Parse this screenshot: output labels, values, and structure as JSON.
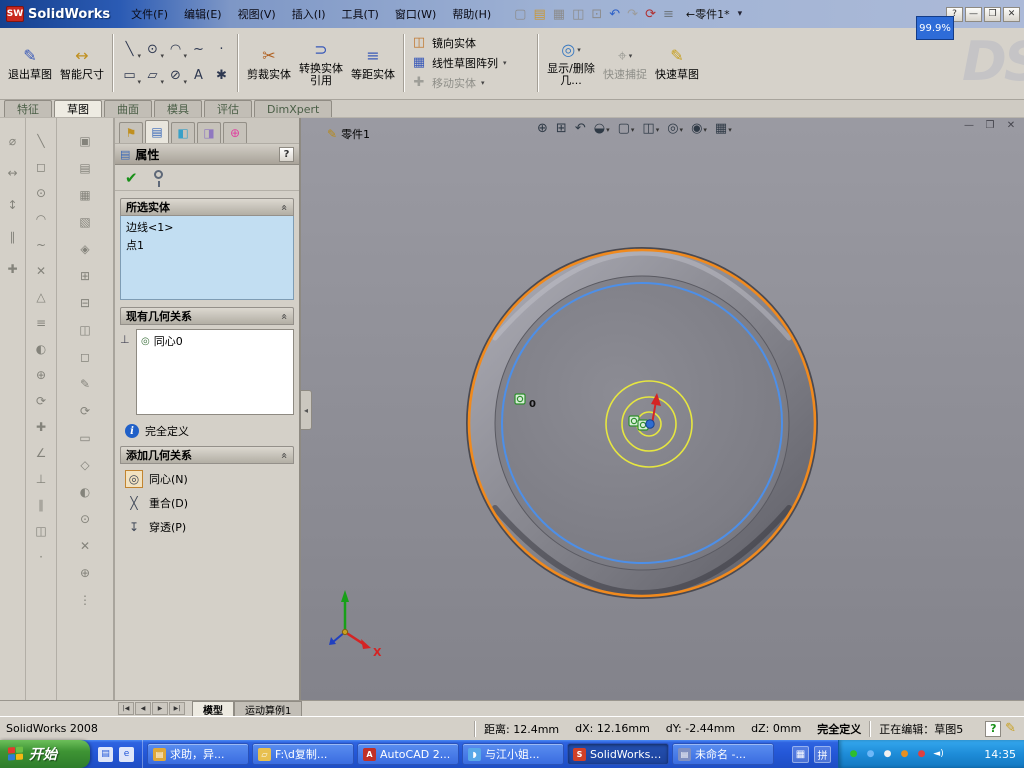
{
  "colors": {
    "selection_orange": "#F08A1E",
    "edge_blue": "#4D8FE8",
    "sketch_yellow": "#E6E640",
    "relation_green": "#2E8E2E",
    "axis_red": "#D42424",
    "axis_green": "#18A018",
    "axis_blue": "#2040C0"
  },
  "titlebar": {
    "logo_badge": "SW",
    "app_name": "SolidWorks",
    "menus": [
      "文件(F)",
      "编辑(E)",
      "视图(V)",
      "插入(I)",
      "工具(T)",
      "窗口(W)",
      "帮助(H)"
    ],
    "toolbar_icons": [
      {
        "name": "new-document-icon",
        "glyph": "▢",
        "color": "#8C8C8C"
      },
      {
        "name": "open-icon",
        "glyph": "▤",
        "color": "#C89838"
      },
      {
        "name": "save-icon",
        "glyph": "▦",
        "color": "#8C8C8C"
      },
      {
        "name": "print-icon",
        "glyph": "◫",
        "color": "#8C8C8C"
      },
      {
        "name": "print-preview-icon",
        "glyph": "⊡",
        "color": "#8C8C8C"
      },
      {
        "name": "undo-icon",
        "glyph": "↶",
        "color": "#2E62C8"
      },
      {
        "name": "redo-icon",
        "glyph": "↷",
        "color": "#9C9C9C"
      },
      {
        "name": "rebuild-icon",
        "glyph": "⟳",
        "color": "#B03030"
      },
      {
        "name": "options-icon",
        "glyph": "≡",
        "color": "#707880"
      }
    ],
    "part_label": "←零件1*",
    "help_label": "?",
    "zoom_badge": "99.9%",
    "watermark": "DS"
  },
  "sketch_toolbar": {
    "exit_sketch": "退出草图",
    "smart_dimension": "智能尺寸",
    "draw_tools": [
      {
        "name": "line-icon",
        "glyph": "╲",
        "caret": true
      },
      {
        "name": "circle-icon",
        "glyph": "⊙",
        "caret": true
      },
      {
        "name": "arc-icon",
        "glyph": "◠",
        "caret": true
      },
      {
        "name": "spline-icon",
        "glyph": "~"
      },
      {
        "name": "point-icon",
        "glyph": "·"
      },
      {
        "name": "rectangle-icon",
        "glyph": "▭",
        "caret": true
      },
      {
        "name": "slot-icon",
        "glyph": "▱",
        "caret": true
      },
      {
        "name": "ellipse-icon",
        "glyph": "⊘",
        "caret": true
      },
      {
        "name": "sketch-text-icon",
        "glyph": "A"
      },
      {
        "name": "star-icon",
        "glyph": "✱"
      }
    ],
    "trim": "剪裁实体",
    "convert": "转换实体引用",
    "offset": "等距实体",
    "mirror": "镜向实体",
    "linear_pattern": "线性草图阵列",
    "move": "移动实体",
    "display_delete": "显示/删除几...",
    "quick_snap": "快速捕捉",
    "rapid_sketch": "快速草图"
  },
  "command_tabs": [
    {
      "name": "features-tab",
      "label": "特征"
    },
    {
      "name": "sketch-tab",
      "label": "草图",
      "active": true
    },
    {
      "name": "surfaces-tab",
      "label": "曲面"
    },
    {
      "name": "mold-tab",
      "label": "模具"
    },
    {
      "name": "evaluate-tab",
      "label": "评估"
    },
    {
      "name": "dimxpert-tab",
      "label": "DimXpert"
    }
  ],
  "left_strips": {
    "col1": [
      {
        "name": "dimension-icon",
        "glyph": "⌀"
      },
      {
        "name": "horizontal-relation-icon",
        "glyph": "↔"
      },
      {
        "name": "vertical-relation-icon",
        "glyph": "↕"
      },
      {
        "name": "parallel-relation-icon",
        "glyph": "∥"
      },
      {
        "name": "fix-relation-icon",
        "glyph": "✚"
      }
    ],
    "col2": [
      {
        "name": "line-tool-icon",
        "glyph": "╲"
      },
      {
        "name": "rectangle-tool-icon",
        "glyph": "◻"
      },
      {
        "name": "circle-tool-icon",
        "glyph": "⊙"
      },
      {
        "name": "arc-tool-icon",
        "glyph": "◠"
      },
      {
        "name": "spline-tool-icon",
        "glyph": "~"
      },
      {
        "name": "erase-tool-icon",
        "glyph": "✕"
      },
      {
        "name": "polygon-tool-icon",
        "glyph": "△"
      },
      {
        "name": "pattern-tool-icon",
        "glyph": "≡"
      },
      {
        "name": "fillet-tool-icon",
        "glyph": "◐"
      },
      {
        "name": "offset-tool-icon",
        "glyph": "⊕"
      },
      {
        "name": "rotate-tool-icon",
        "glyph": "⟳"
      },
      {
        "name": "add-relation-icon",
        "glyph": "✚"
      },
      {
        "name": "angle-tool-icon",
        "glyph": "∠"
      },
      {
        "name": "perpendicular-tool-icon",
        "glyph": "⊥"
      },
      {
        "name": "parallel-tool-icon",
        "glyph": "∥"
      },
      {
        "name": "mirror-tool-icon",
        "glyph": "◫"
      },
      {
        "name": "point-tool-icon",
        "glyph": "·"
      }
    ],
    "col3": [
      {
        "name": "extrude-icon",
        "glyph": "▣"
      },
      {
        "name": "revolve-icon",
        "glyph": "▤"
      },
      {
        "name": "sweep-icon",
        "glyph": "▦"
      },
      {
        "name": "loft-icon",
        "glyph": "▧"
      },
      {
        "name": "shell-icon",
        "glyph": "◈"
      },
      {
        "name": "feature-pattern-icon",
        "glyph": "⊞"
      },
      {
        "name": "feature-mirror-icon",
        "glyph": "⊟"
      },
      {
        "name": "rib-icon",
        "glyph": "◫"
      },
      {
        "name": "draft-icon",
        "glyph": "◻"
      },
      {
        "name": "sketch-edit-icon",
        "glyph": "✎"
      },
      {
        "name": "rebuild-tree-icon",
        "glyph": "⟳"
      },
      {
        "name": "plane-icon",
        "glyph": "▭"
      },
      {
        "name": "axis-icon",
        "glyph": "◇"
      },
      {
        "name": "fillet-feature-icon",
        "glyph": "◐"
      },
      {
        "name": "hole-icon",
        "glyph": "⊙"
      },
      {
        "name": "delete-feature-icon",
        "glyph": "✕"
      },
      {
        "name": "add-feature-icon",
        "glyph": "⊕"
      },
      {
        "name": "more-tools-icon",
        "glyph": "⋮"
      }
    ]
  },
  "property_manager": {
    "tabs": [
      {
        "name": "feature-manager-tab",
        "glyph": "⚑",
        "color": "#C09020"
      },
      {
        "name": "property-manager-tab",
        "glyph": "▤",
        "color": "#3868B8",
        "active": true
      },
      {
        "name": "configuration-manager-tab",
        "glyph": "◧",
        "color": "#38A0C8"
      },
      {
        "name": "dimxpert-manager-tab",
        "glyph": "◨",
        "color": "#9078C0"
      },
      {
        "name": "display-manager-tab",
        "glyph": "⊕",
        "color": "#E040A0"
      }
    ],
    "title": "属性",
    "help_label": "?",
    "selected_entities": {
      "header": "所选实体",
      "items": [
        "边线<1>",
        "点1"
      ]
    },
    "existing_relations": {
      "header": "现有几何关系",
      "items": [
        {
          "name": "concentric-relation-item",
          "glyph": "◎",
          "label": "同心0"
        }
      ],
      "status": "完全定义"
    },
    "add_relations": {
      "header": "添加几何关系",
      "options": [
        {
          "name": "concentric-relation-option",
          "glyph": "◎",
          "label": "同心(N)",
          "active": true
        },
        {
          "name": "coincident-relation-option",
          "glyph": "╳",
          "label": "重合(D)"
        },
        {
          "name": "pierce-relation-option",
          "glyph": "↧",
          "label": "穿透(P)"
        }
      ]
    }
  },
  "viewport": {
    "model_label": "零件1",
    "hud_icons": [
      {
        "name": "zoom-fit-icon",
        "glyph": "⊕"
      },
      {
        "name": "zoom-area-icon",
        "glyph": "⊞"
      },
      {
        "name": "previous-view-icon",
        "glyph": "↶"
      },
      {
        "name": "section-view-icon",
        "glyph": "◒",
        "caret": true
      },
      {
        "name": "view-orientation-icon",
        "glyph": "▢",
        "caret": true
      },
      {
        "name": "display-style-icon",
        "glyph": "◫",
        "caret": true
      },
      {
        "name": "hide-show-items-icon",
        "glyph": "◎",
        "caret": true
      },
      {
        "name": "appearance-icon",
        "glyph": "◉",
        "caret": true
      },
      {
        "name": "scene-icon",
        "glyph": "▦",
        "caret": true
      }
    ],
    "window_buttons": {
      "minimize": "—",
      "restore": "❒",
      "close": "✕"
    },
    "origin_point_label": "0",
    "axis_x_label": "X"
  },
  "model_tabs": {
    "nav": [
      {
        "name": "first-tab-button",
        "glyph": "|◀"
      },
      {
        "name": "prev-tab-button",
        "glyph": "◀"
      },
      {
        "name": "next-tab-button",
        "glyph": "▶"
      },
      {
        "name": "last-tab-button",
        "glyph": "▶|"
      }
    ],
    "tabs": [
      {
        "name": "model-tab",
        "label": "模型",
        "active": true
      },
      {
        "name": "motion-study-tab",
        "label": "运动算例1"
      }
    ]
  },
  "statusbar": {
    "app_version": "SolidWorks 2008",
    "distance": "距离: 12.4mm",
    "dx": "dX: 12.16mm",
    "dy": "dY: -2.44mm",
    "dz": "dZ: 0mm",
    "state": "完全定义",
    "editing": "正在编辑：草图5",
    "help_label": "?"
  },
  "taskbar": {
    "start_label": "开始",
    "quick_launch": [
      {
        "name": "show-desktop-icon",
        "glyph": "▤"
      },
      {
        "name": "ie-icon",
        "glyph": "e"
      }
    ],
    "tasks": [
      {
        "name": "task-button-help-doc",
        "label": "求助，异...",
        "icon_bg": "#E0A838",
        "glyph": "▤"
      },
      {
        "name": "task-button-folder",
        "label": "F:\\d复制...",
        "icon_bg": "#E8C050",
        "glyph": "▱"
      },
      {
        "name": "task-button-autocad",
        "label": "AutoCAD 2...",
        "icon_bg": "#C03028",
        "glyph": "A"
      },
      {
        "name": "task-button-chat",
        "label": "与江小姐...",
        "icon_bg": "#58A8E8",
        "glyph": "◗"
      },
      {
        "name": "task-button-solidworks",
        "label": "SolidWorks ...",
        "icon_bg": "#D04028",
        "glyph": "S",
        "active": true
      },
      {
        "name": "task-button-untitled",
        "label": "未命名 -...",
        "icon_bg": "#8090C0",
        "glyph": "▤"
      }
    ],
    "indicator_icons": [
      {
        "name": "ime-keyboard-icon",
        "glyph": "▦"
      },
      {
        "name": "ime-lang-icon",
        "glyph": "拼"
      }
    ],
    "tray_icons": [
      {
        "name": "antivirus-tray-icon",
        "glyph": "●",
        "color": "#2EBE2E"
      },
      {
        "name": "messenger-tray-icon",
        "glyph": "●",
        "color": "#6EB8F8"
      },
      {
        "name": "qq-tray-icon",
        "glyph": "●",
        "color": "#F0F0F0"
      },
      {
        "name": "download-tray-icon",
        "glyph": "●",
        "color": "#E89020"
      },
      {
        "name": "security-tray-icon",
        "glyph": "●",
        "color": "#E04040"
      },
      {
        "name": "volume-icon",
        "glyph": "◄)",
        "color": "#FFFFFF"
      }
    ],
    "time": "14:35"
  }
}
